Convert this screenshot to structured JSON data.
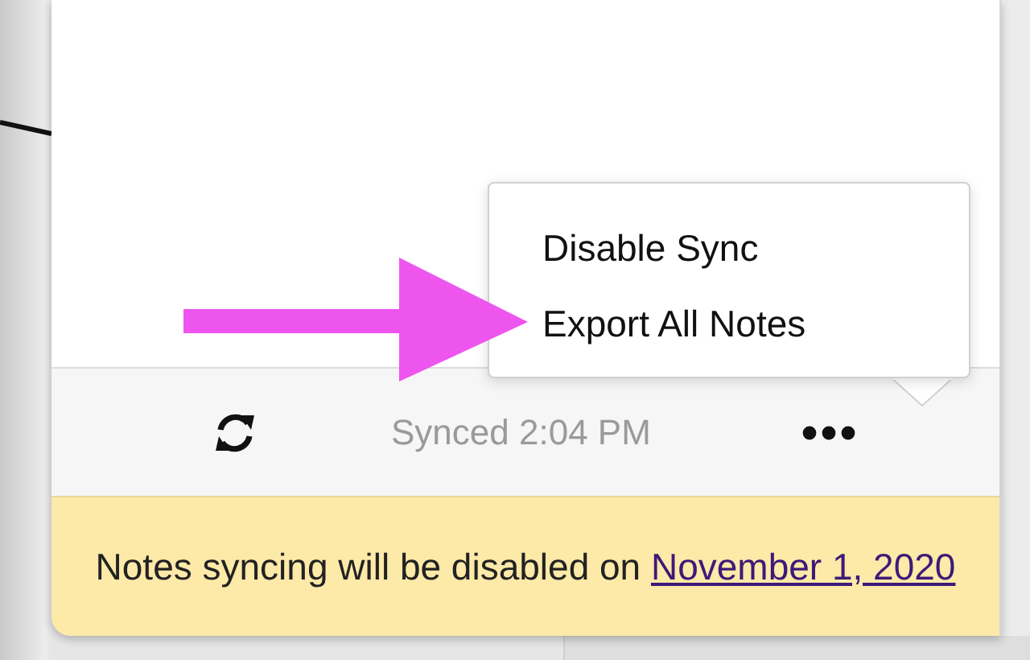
{
  "menu": {
    "items": [
      {
        "label": "Disable Sync"
      },
      {
        "label": "Export All Notes"
      }
    ]
  },
  "footer": {
    "status": "Synced 2:04 PM"
  },
  "banner": {
    "text": "Notes syncing will be disabled on",
    "link": "November 1, 2020"
  },
  "annotation": {
    "kind": "arrow",
    "color": "#ee55ee"
  }
}
